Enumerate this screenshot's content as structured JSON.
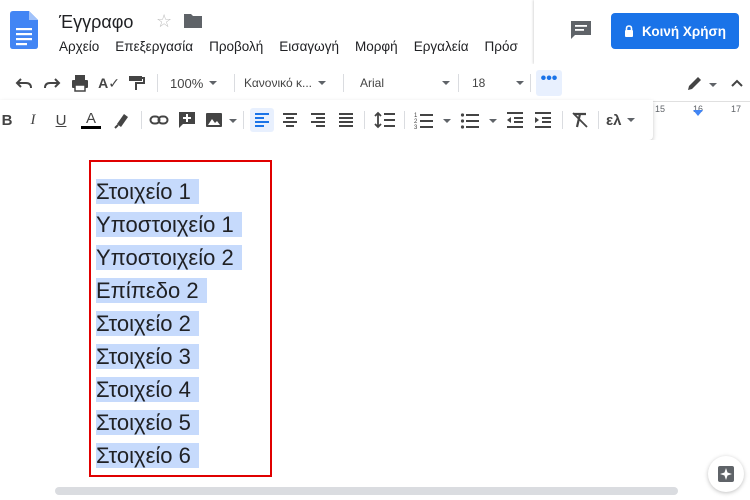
{
  "header": {
    "doc_title": "Έγγραφο",
    "share_label": "Κοινή Χρήση",
    "menus": [
      "Αρχείο",
      "Επεξεργασία",
      "Προβολή",
      "Εισαγωγή",
      "Μορφή",
      "Εργαλεία",
      "Πρόσ"
    ]
  },
  "toolbar": {
    "zoom": "100%",
    "style": "Κανονικό κ...",
    "font": "Arial",
    "font_size": "18",
    "input_tools_label": "ελ"
  },
  "ruler": {
    "marks": [
      "15",
      "16",
      "17"
    ]
  },
  "document": {
    "lines": [
      "Στοιχείο 1",
      "Υποστοιχείο 1",
      "Υποστοιχείο 2",
      "Επίπεδο 2",
      "Στοιχείο 2",
      "Στοιχείο 3",
      "Στοιχείο 4",
      "Στοιχείο 5",
      "Στοιχείο 6"
    ]
  },
  "colors": {
    "accent": "#1a73e8",
    "selection": "#c6dafc",
    "highlight_box": "#e00000",
    "docs_blue": "#4285f4"
  },
  "icons": [
    "docs-logo-icon",
    "star-icon",
    "folder-icon",
    "comment-icon",
    "lock-icon",
    "undo-icon",
    "redo-icon",
    "print-icon",
    "spellcheck-icon",
    "paint-format-icon",
    "more-icon",
    "edit-mode-icon",
    "collapse-icon",
    "bold-icon",
    "italic-icon",
    "underline-icon",
    "text-color-icon",
    "highlight-icon",
    "link-icon",
    "add-comment-icon",
    "image-icon",
    "align-left-icon",
    "align-center-icon",
    "align-right-icon",
    "justify-icon",
    "line-spacing-icon",
    "numbered-list-icon",
    "bulleted-list-icon",
    "decrease-indent-icon",
    "increase-indent-icon",
    "clear-formatting-icon",
    "explore-icon"
  ]
}
